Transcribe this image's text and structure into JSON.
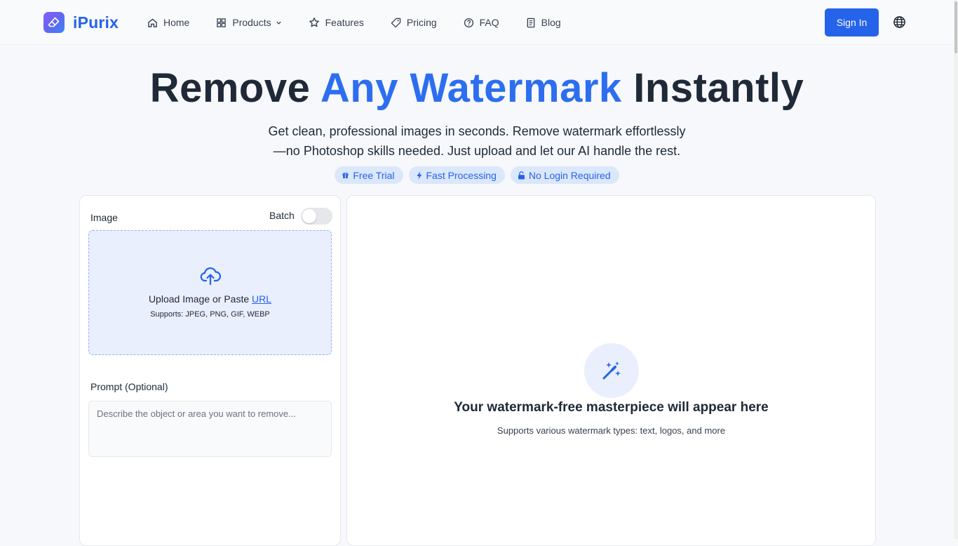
{
  "brand": {
    "name": "iPurix",
    "color": "#2563eb"
  },
  "nav": [
    {
      "label": "Home",
      "icon": "home-icon"
    },
    {
      "label": "Products",
      "icon": "grid-icon",
      "has_dropdown": true
    },
    {
      "label": "Features",
      "icon": "star-icon"
    },
    {
      "label": "Pricing",
      "icon": "tag-icon"
    },
    {
      "label": "FAQ",
      "icon": "help-circle-icon"
    },
    {
      "label": "Blog",
      "icon": "document-icon"
    }
  ],
  "header": {
    "sign_in": "Sign In",
    "language_icon": "globe-icon"
  },
  "hero": {
    "title_before": "Remove ",
    "title_accent": "Any Watermark",
    "title_after": " Instantly",
    "subtitle_line1": "Get clean, professional images in seconds. Remove watermark effortlessly",
    "subtitle_line2": "—no Photoshop skills needed. Just upload and let our AI handle the rest.",
    "badges": [
      {
        "label": "Free Trial",
        "icon": "gift-icon"
      },
      {
        "label": "Fast Processing",
        "icon": "bolt-icon"
      },
      {
        "label": "No Login Required",
        "icon": "unlock-icon"
      }
    ]
  },
  "upload_panel": {
    "image_label": "Image",
    "batch_label": "Batch",
    "batch_enabled": false,
    "upload_text": "Upload Image or Paste ",
    "upload_link": "URL",
    "supports": "Supports: JPEG, PNG, GIF, WEBP",
    "prompt_label": "Prompt (Optional)",
    "prompt_placeholder": "Describe the object or area you want to remove...",
    "prompt_value": ""
  },
  "result_panel": {
    "title": "Your watermark-free masterpiece will appear here",
    "subtitle": "Supports various watermark types: text, logos, and more",
    "icon": "magic-wand-icon"
  },
  "colors": {
    "primary": "#2563eb",
    "accent_text": "#2d6ef0",
    "badge_bg": "#dbe7fb",
    "dropzone_bg": "#e9effd",
    "page_bg": "#f6f8fb"
  }
}
